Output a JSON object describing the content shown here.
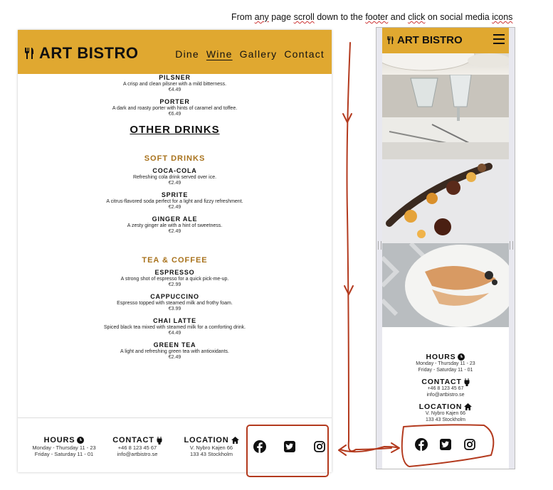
{
  "instruction": {
    "pre": "From ",
    "w1": "any",
    "mid1": " page ",
    "w2": "scroll",
    "mid2": " down to the ",
    "w3": "footer",
    "mid3": " and ",
    "w4": "click",
    "mid4": " on social media ",
    "w5": "icons"
  },
  "brand": "ART BISTRO",
  "nav": {
    "links": [
      "Dine",
      "Wine",
      "Gallery",
      "Contact"
    ],
    "active": "Wine"
  },
  "menu": {
    "beers": [
      {
        "name": "PILSNER",
        "desc": "A crisp and clean pilsner with a mild bitterness.",
        "price": "€4.49"
      },
      {
        "name": "PORTER",
        "desc": "A dark and roasty porter with hints of caramel and toffee.",
        "price": "€6.49"
      }
    ],
    "other_heading": "OTHER DRINKS",
    "soft_title": "SOFT DRINKS",
    "soft": [
      {
        "name": "COCA-COLA",
        "desc": "Refreshing cola drink served over ice.",
        "price": "€2.49"
      },
      {
        "name": "SPRITE",
        "desc": "A citrus-flavored soda perfect for a light and fizzy refreshment.",
        "price": "€2.49"
      },
      {
        "name": "GINGER ALE",
        "desc": "A zesty ginger ale with a hint of sweetness.",
        "price": "€2.49"
      }
    ],
    "tea_title": "TEA & COFFEE",
    "tea": [
      {
        "name": "ESPRESSO",
        "desc": "A strong shot of espresso for a quick pick-me-up.",
        "price": "€2.99"
      },
      {
        "name": "CAPPUCCINO",
        "desc": "Espresso topped with steamed milk and frothy foam.",
        "price": "€3.99"
      },
      {
        "name": "CHAI LATTE",
        "desc": "Spiced black tea mixed with steamed milk for a comforting drink.",
        "price": "€4.49"
      },
      {
        "name": "GREEN TEA",
        "desc": "A light and refreshing green tea with antioxidants.",
        "price": "€2.49"
      }
    ]
  },
  "footer": {
    "hours_title": "HOURS",
    "hours": [
      "Monday - Thursday 11 - 23",
      "Friday - Saturday 11 - 01"
    ],
    "contact_title": "CONTACT",
    "contact": [
      "+46 8 123 45 67",
      "info@artbistro.se"
    ],
    "location_title": "LOCATION",
    "location": [
      "V. Nybro Kajen 66",
      "133 43 Stockholm"
    ],
    "socials": [
      "facebook-icon",
      "twitter-icon",
      "instagram-icon"
    ]
  },
  "colors": {
    "accent": "#e0a830",
    "category": "#a8721c",
    "annotation": "#b33a1e"
  }
}
